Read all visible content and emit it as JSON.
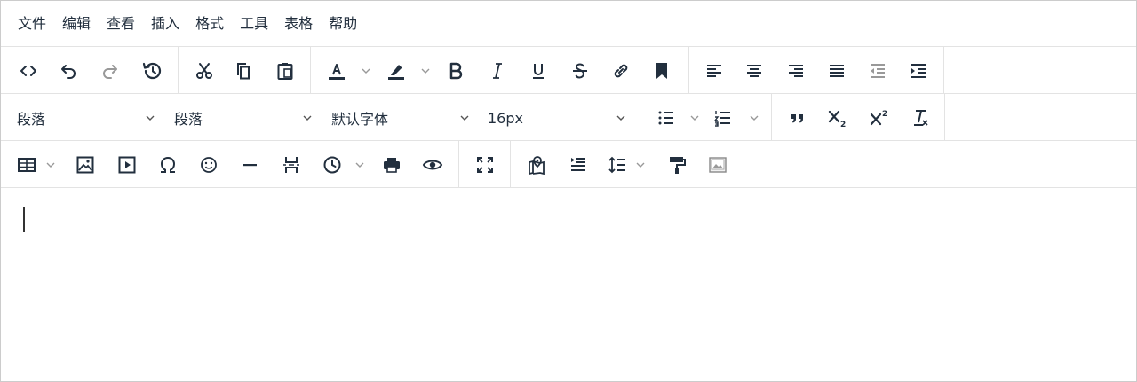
{
  "menubar": {
    "items": [
      "文件",
      "编辑",
      "查看",
      "插入",
      "格式",
      "工具",
      "表格",
      "帮助"
    ]
  },
  "format_bar": {
    "block_format": "段落",
    "paragraph_format": "段落",
    "font_family": "默认字体",
    "font_size": "16px"
  },
  "icons": {
    "row1": [
      "code-icon",
      "undo-icon",
      "redo-icon",
      "restore-draft-icon",
      "cut-icon",
      "copy-icon",
      "paste-icon",
      "text-color-icon",
      "highlight-color-icon",
      "bold-icon",
      "italic-icon",
      "underline-icon",
      "strikethrough-icon",
      "link-icon",
      "bookmark-icon",
      "align-left-icon",
      "align-center-icon",
      "align-right-icon",
      "align-justify-icon",
      "outdent-icon",
      "indent-icon"
    ],
    "row2": [
      "bullet-list-icon",
      "numbered-list-icon",
      "blockquote-icon",
      "subscript-icon",
      "superscript-icon",
      "remove-format-icon"
    ],
    "row3": [
      "table-icon",
      "image-icon",
      "media-icon",
      "special-char-icon",
      "emoticon-icon",
      "horizontal-rule-icon",
      "page-break-icon",
      "insert-datetime-icon",
      "print-icon",
      "preview-icon",
      "fullscreen-icon",
      "map-pin-icon",
      "line-spacing-icon",
      "line-height-icon",
      "format-painter-icon",
      "image-gallery-icon"
    ]
  },
  "colors": {
    "icon": "#222f3e",
    "disabled_icon": "#999999",
    "text_color_bar": "#222f3e",
    "border": "#cccccc",
    "divider": "#e3e3e3"
  }
}
